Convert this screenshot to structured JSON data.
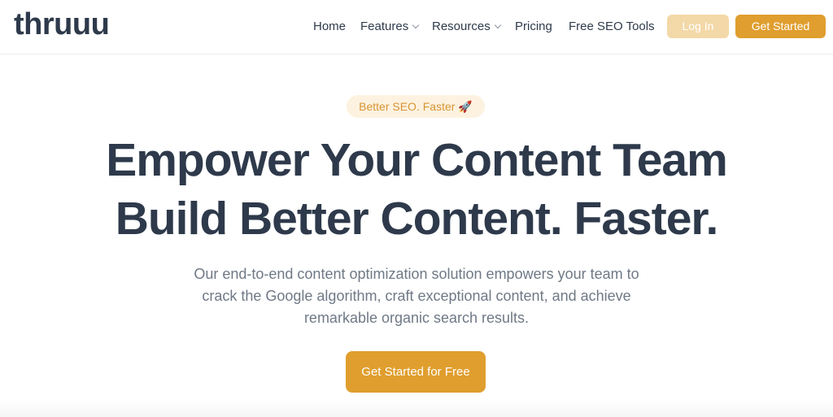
{
  "brand": {
    "logo_text": "thruuu"
  },
  "nav": {
    "home": "Home",
    "features": "Features",
    "resources": "Resources",
    "pricing": "Pricing",
    "free_seo_tools": "Free SEO Tools",
    "login": "Log In",
    "get_started": "Get Started"
  },
  "hero": {
    "badge": "Better SEO. Faster",
    "badge_icon": "rocket-icon",
    "headline_line1": "Empower Your Content Team",
    "headline_line2": "Build Better Content. Faster.",
    "sub_line1": "Our end-to-end content optimization solution empowers your team to",
    "sub_line2": "crack the Google algorithm, craft exceptional content, and achieve",
    "sub_line3": "remarkable organic search results.",
    "cta": "Get Started for Free"
  },
  "colors": {
    "accent": "#e09e2e",
    "accent_light": "#f3d8a8",
    "text_dark": "#2e3a4b",
    "text_muted": "#6f7986"
  }
}
